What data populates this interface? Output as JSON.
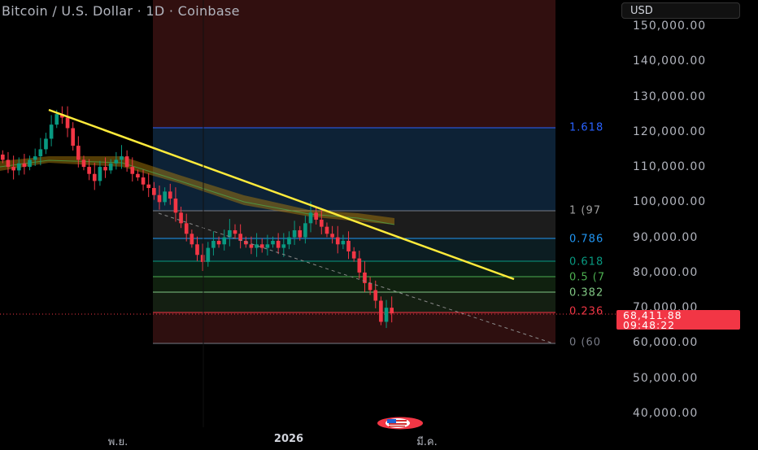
{
  "header": {
    "title": "Bitcoin / U.S. Dollar · 1D · Coinbase",
    "currency": "USD"
  },
  "price_axis": [
    "150,000.00",
    "140,000.00",
    "130,000.00",
    "120,000.00",
    "110,000.00",
    "100,000.00",
    "90,000.00",
    "80,000.00",
    "70,000.00",
    "60,000.00",
    "50,000.00",
    "40,000.00"
  ],
  "last_price": {
    "price": "68,411.88",
    "countdown": "09:48:22"
  },
  "time_axis": [
    "พ.ย.",
    "2026",
    "มี.ค."
  ],
  "fib_labels": [
    {
      "label": "1.618",
      "price": 121200,
      "color": "#2962ff"
    },
    {
      "label": "1 (97",
      "price": 97500,
      "color": "#9e9e9e"
    },
    {
      "label": "0.786",
      "price": 89500,
      "color": "#2196f3"
    },
    {
      "label": "0.618",
      "price": 83000,
      "color": "#089981"
    },
    {
      "label": "0.5 (7",
      "price": 78700,
      "color": "#4caf50"
    },
    {
      "label": "0.382",
      "price": 74300,
      "color": "#81c784"
    },
    {
      "label": "0.236",
      "price": 68800,
      "color": "#f23645"
    },
    {
      "label": "0 (60",
      "price": 60000,
      "color": "#787b86"
    }
  ],
  "colors": {
    "up": "#089981",
    "down": "#f23645",
    "trendline": "#ffeb3b"
  },
  "chart_data": {
    "type": "candlestick",
    "title": "Bitcoin / U.S. Dollar · 1D · Coinbase",
    "ylim": [
      40000,
      150000
    ],
    "closes_k": [
      112,
      110,
      109,
      111,
      110,
      112,
      113,
      115,
      118,
      122,
      125,
      124,
      121,
      116,
      112,
      110,
      108,
      106,
      110,
      109,
      111,
      112,
      113,
      110,
      108,
      107,
      105,
      104,
      102,
      100,
      103,
      101,
      97,
      94,
      91,
      88,
      85,
      83,
      87,
      89,
      88,
      90,
      92,
      91,
      89,
      88,
      87,
      88,
      87,
      88,
      89,
      87,
      88,
      90,
      92,
      90,
      94,
      97,
      95,
      93,
      91,
      90,
      88,
      89,
      86,
      84,
      80,
      77,
      75,
      72,
      66,
      70,
      68.4
    ],
    "last": 68411.88
  }
}
